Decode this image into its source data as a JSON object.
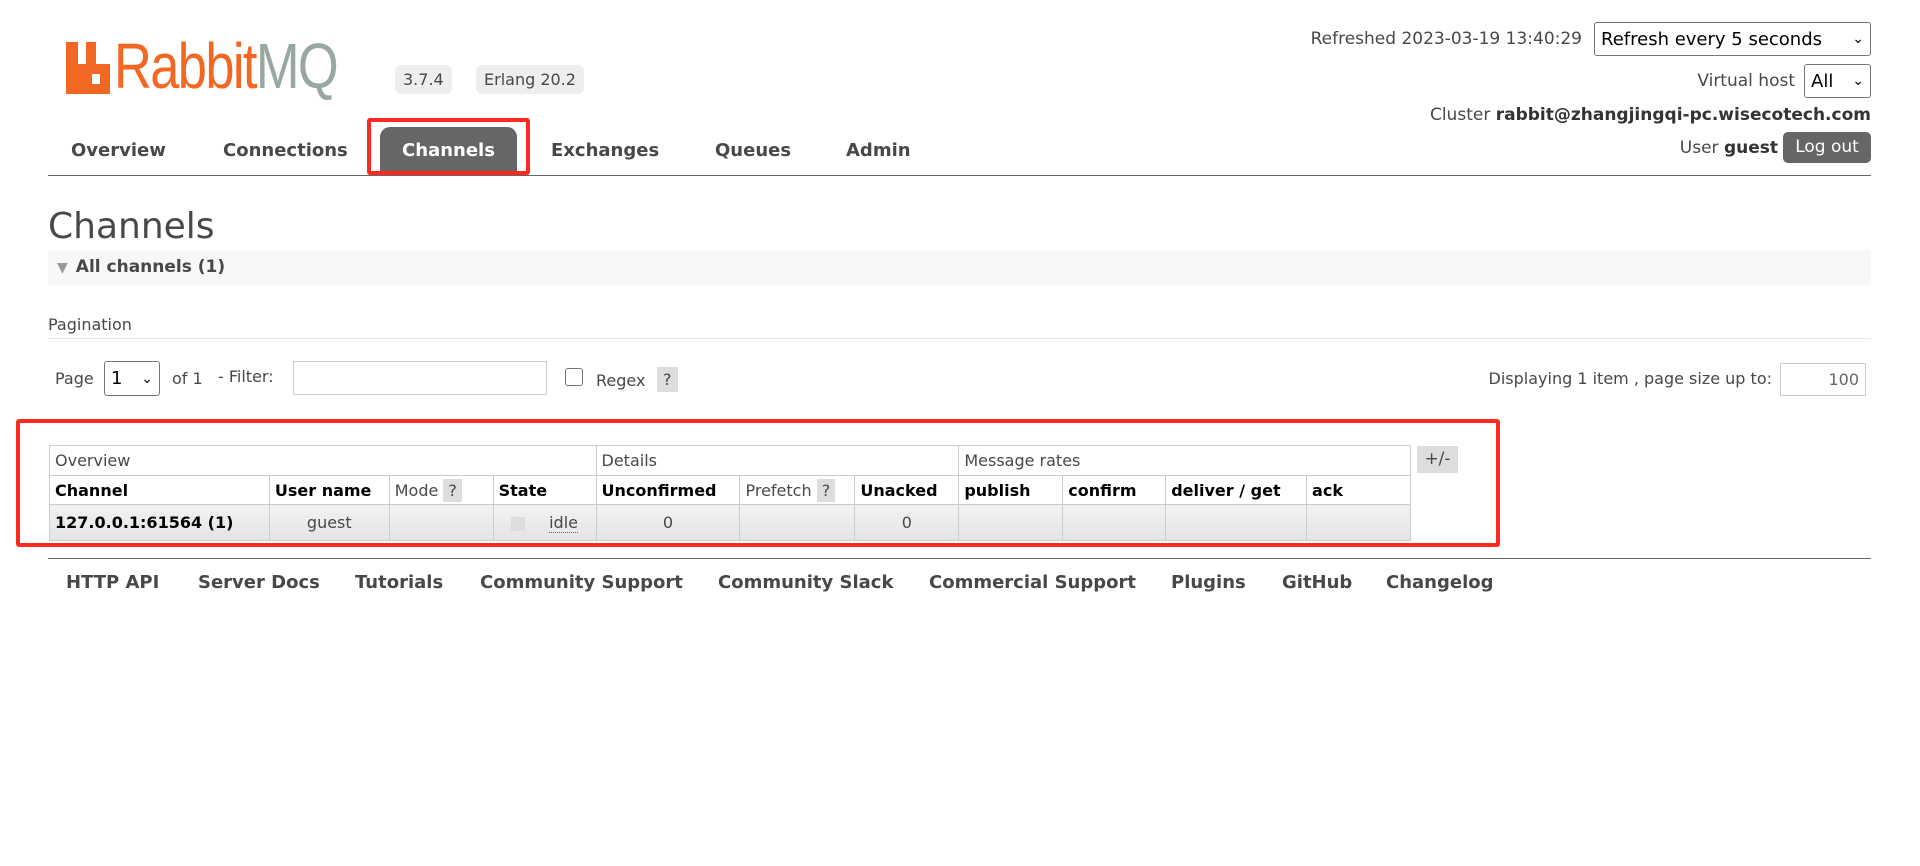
{
  "header": {
    "logo_text": "RabbitMQ",
    "version": "3.7.4",
    "erlang": "Erlang 20.2",
    "refreshed_label": "Refreshed 2023-03-19 13:40:29",
    "refresh_select": "Refresh every 5 seconds",
    "vhost_label": "Virtual host",
    "vhost_select": "All",
    "cluster_label": "Cluster",
    "cluster_name": "rabbit@zhangjingqi-pc.wisecotech.com",
    "user_label": "User",
    "user_name": "guest",
    "logout": "Log out"
  },
  "nav": {
    "tabs": [
      {
        "label": "Overview"
      },
      {
        "label": "Connections"
      },
      {
        "label": "Channels",
        "active": true
      },
      {
        "label": "Exchanges"
      },
      {
        "label": "Queues"
      },
      {
        "label": "Admin"
      }
    ]
  },
  "page": {
    "title": "Channels",
    "section": "All channels (1)",
    "pagination_label": "Pagination",
    "page_label": "Page",
    "page_value": "1",
    "of_label": "of 1",
    "filter_label": "- Filter:",
    "filter_value": "",
    "regex_label": "Regex",
    "help": "?",
    "displaying": "Displaying 1 item , page size up to:",
    "page_size": "100"
  },
  "table": {
    "groups": [
      "Overview",
      "Details",
      "Message rates"
    ],
    "toggle": "+/-",
    "headers": [
      "Channel",
      "User name",
      "Mode",
      "State",
      "Unconfirmed",
      "Prefetch",
      "Unacked",
      "publish",
      "confirm",
      "deliver / get",
      "ack"
    ],
    "rows": [
      {
        "channel": "127.0.0.1:61564 (1)",
        "user": "guest",
        "mode": "",
        "state": "idle",
        "unconfirmed": "0",
        "prefetch": "",
        "unacked": "0",
        "publish": "",
        "confirm": "",
        "deliver": "",
        "ack": ""
      }
    ]
  },
  "footer": {
    "links": [
      "HTTP API",
      "Server Docs",
      "Tutorials",
      "Community Support",
      "Community Slack",
      "Commercial Support",
      "Plugins",
      "GitHub",
      "Changelog"
    ]
  },
  "colors": {
    "brand": "#f26722",
    "highlight": "#ff2a1f",
    "active_tab": "#666666"
  }
}
